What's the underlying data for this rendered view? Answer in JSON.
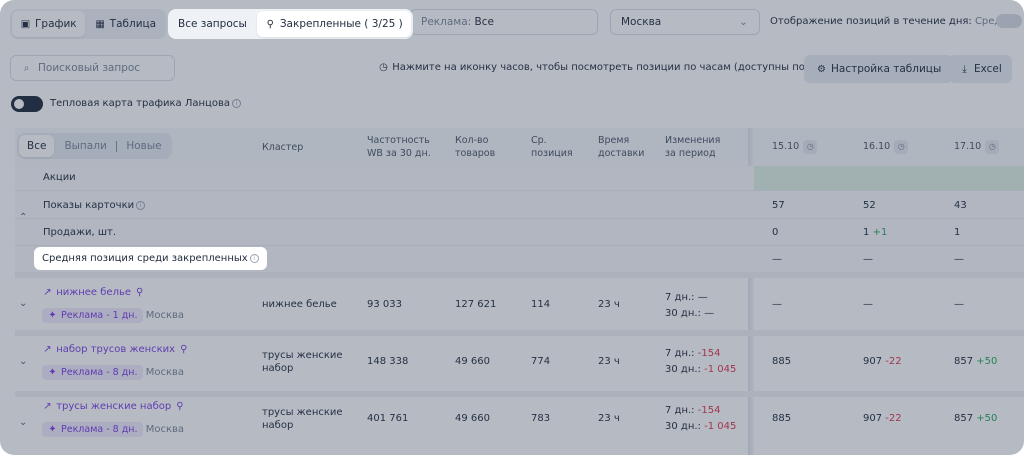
{
  "view_switch": {
    "chart": "График",
    "table": "Таблица"
  },
  "query_tabs": {
    "all": "Все запросы",
    "pinned": "Закрепленные ( 3/25 )"
  },
  "ads_select": {
    "label": "Реклама:",
    "value": "Все"
  },
  "city_select": {
    "value": "Москва"
  },
  "day_positions": {
    "label": "Отображение позиций в течение дня:",
    "value": "Средняя"
  },
  "search": {
    "placeholder": "Поисковый запрос"
  },
  "hint": "Нажмите на иконку часов, чтобы посмотреть позиции по часам (доступны по Москве)",
  "settings_button": "Настройка таблицы",
  "excel_button": "Excel",
  "heatmap": {
    "label": "Тепловая карта трафика Ланцова"
  },
  "filter": {
    "all": "Все",
    "dropped": "Выпали",
    "sep": "|",
    "new": "Новые"
  },
  "columns": {
    "cluster": "Кластер",
    "freq": [
      "Частотность",
      "WB за 30 дн."
    ],
    "goods": [
      "Кол-во",
      "товаров"
    ],
    "avgpos": [
      "Ср.",
      "позиция"
    ],
    "delivery": [
      "Время",
      "доставки"
    ],
    "changes": [
      "Изменения",
      "за период"
    ]
  },
  "dates": [
    "15.10",
    "16.10",
    "17.10"
  ],
  "summary": {
    "promos": "Акции",
    "views": {
      "label": "Показы карточки",
      "values": [
        "57",
        "52",
        "43"
      ]
    },
    "sales": {
      "label": "Продажи, шт.",
      "values": [
        "0",
        "1",
        "1"
      ],
      "delta16": "+1"
    },
    "avgpin": {
      "label": "Средняя позиция среди закрепленных",
      "values": [
        "—",
        "—",
        "—"
      ]
    }
  },
  "rows": [
    {
      "query": "нижнее белье",
      "ad": "Реклама - 1 дн.",
      "city": "Москва",
      "cluster": [
        "нижнее белье",
        ""
      ],
      "freq": "93 033",
      "goods": "127 621",
      "avgpos": "114",
      "delivery": "23 ч",
      "ch7_label": "7 дн.:",
      "ch7": "—",
      "ch30_label": "30 дн.:",
      "ch30": "—",
      "d1": "—",
      "d2": "—",
      "d2delta": "",
      "d3": "—",
      "d3delta": ""
    },
    {
      "query": "набор трусов женских",
      "ad": "Реклама - 8 дн.",
      "city": "Москва",
      "cluster": [
        "трусы женские",
        "набор"
      ],
      "freq": "148 338",
      "goods": "49 660",
      "avgpos": "774",
      "delivery": "23 ч",
      "ch7_label": "7 дн.:",
      "ch7": "-154",
      "ch30_label": "30 дн.:",
      "ch30": "-1 045",
      "d1": "885",
      "d2": "907",
      "d2delta": "-22",
      "d3": "857",
      "d3delta": "+50"
    },
    {
      "query": "трусы женские набор",
      "ad": "Реклама - 8 дн.",
      "city": "Москва",
      "cluster": [
        "трусы женские",
        "набор"
      ],
      "freq": "401 761",
      "goods": "49 660",
      "avgpos": "783",
      "delivery": "23 ч",
      "ch7_label": "7 дн.:",
      "ch7": "-154",
      "ch30_label": "30 дн.:",
      "ch30": "-1 045",
      "d1": "885",
      "d2": "907",
      "d2delta": "-22",
      "d3": "857",
      "d3delta": "+50"
    }
  ]
}
